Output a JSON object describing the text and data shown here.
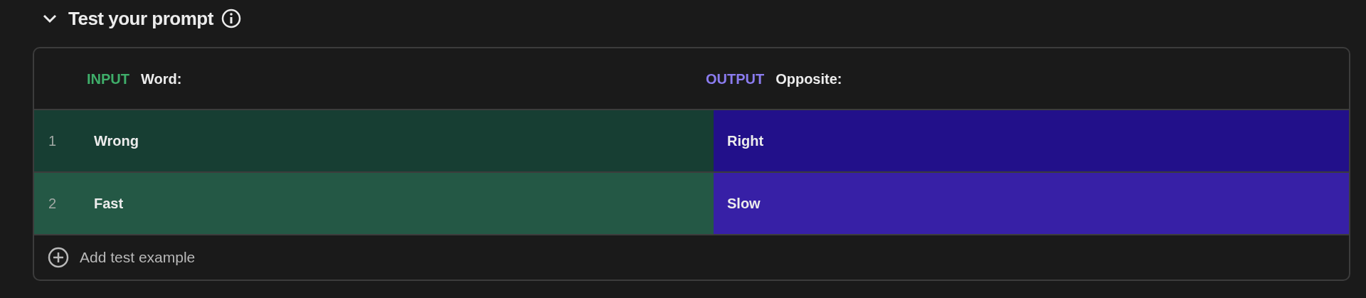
{
  "section": {
    "title": "Test your prompt",
    "expanded": true
  },
  "columns": [
    {
      "kind": "input",
      "tag": "INPUT",
      "label": "Word:"
    },
    {
      "kind": "output",
      "tag": "OUTPUT",
      "label": "Opposite:"
    }
  ],
  "rows": [
    {
      "number": "1",
      "input": "Wrong",
      "output": "Right",
      "selected": false
    },
    {
      "number": "2",
      "input": "Fast",
      "output": "Slow",
      "selected": true
    }
  ],
  "add_button": {
    "label": "Add test example"
  }
}
